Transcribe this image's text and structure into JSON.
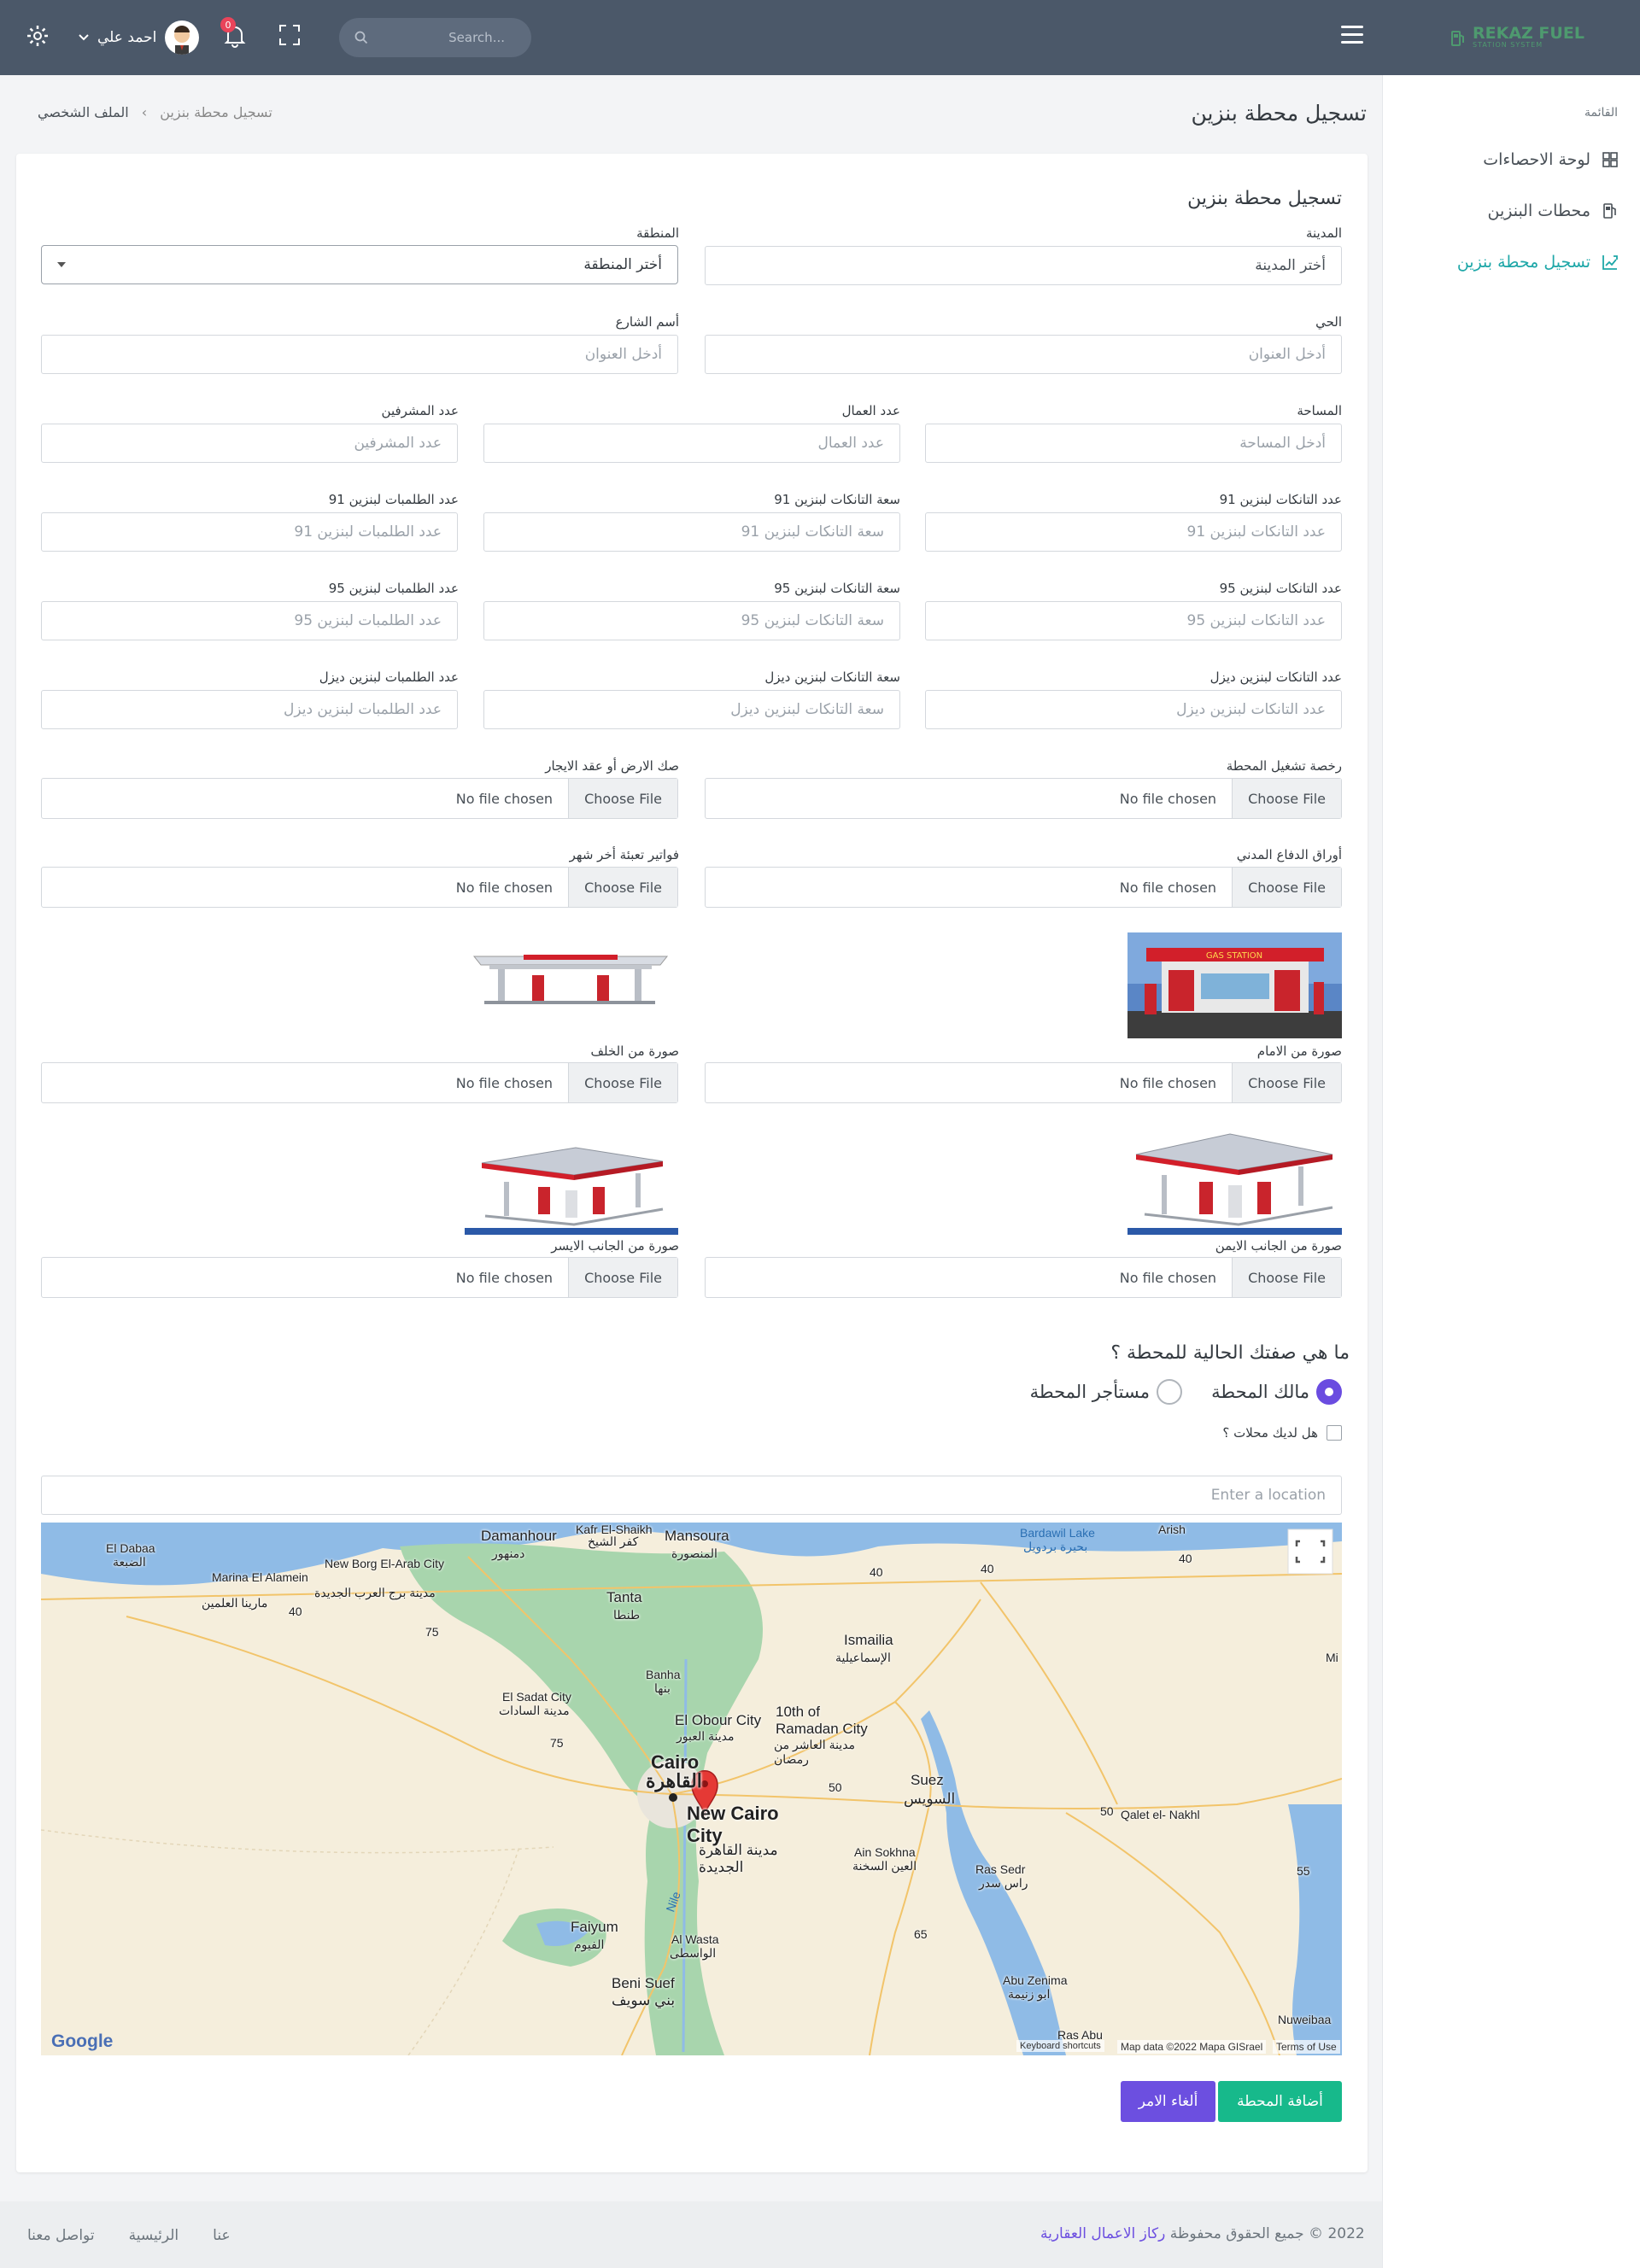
{
  "header": {
    "brand_name": "REKAZ FUEL",
    "brand_sub": "STATION SYSTEM",
    "search_placeholder": "Search...",
    "notifications_count": "0",
    "user_name": "احمد علي"
  },
  "sidebar": {
    "title": "القائمة",
    "items": [
      {
        "label": "لوحة الاحصاءات",
        "icon": "dashboard-icon"
      },
      {
        "label": "محطات البنزين",
        "icon": "fuel-pump-icon"
      },
      {
        "label": "تسجيل محطة بنزين",
        "icon": "chart-add-icon"
      }
    ]
  },
  "page": {
    "title": "تسجيل محطة بنزين",
    "breadcrumb_root": "الملف الشخصي",
    "breadcrumb_sep": "›",
    "breadcrumb_current": "تسجيل محطة بنزين"
  },
  "form": {
    "title": "تسجيل محطة بنزين",
    "city_label": "المدينة",
    "city_value": "أختر المدينة",
    "region_label": "المنطقة",
    "region_value": "أختر المنطقة",
    "district_label": "الحي",
    "district_placeholder": "أدخل العنوان",
    "street_label": "أسم الشارع",
    "street_placeholder": "أدخل العنوان",
    "area_label": "المساحة",
    "area_placeholder": "أدخل المساحة",
    "workers_label": "عدد العمال",
    "workers_placeholder": "عدد العمال",
    "supervisors_label": "عدد المشرفين",
    "supervisors_placeholder": "عدد المشرفين",
    "tanks91_label": "عدد التانكات لبنزين 91",
    "tanks91_placeholder": "عدد التانكات لبنزين 91",
    "cap91_label": "سعة التانكات لبنزين 91",
    "cap91_placeholder": "سعة التانكات لبنزين 91",
    "pumps91_label": "عدد الطلمبات لبنزين 91",
    "pumps91_placeholder": "عدد الطلمبات لبنزين 91",
    "tanks95_label": "عدد التانكات لبنزين 95",
    "tanks95_placeholder": "عدد التانكات لبنزين 95",
    "cap95_label": "سعة التانكات لبنزين 95",
    "cap95_placeholder": "سعة التانكات لبنزين 95",
    "pumps95_label": "عدد الطلمبات لبنزين 95",
    "pumps95_placeholder": "عدد الطلمبات لبنزين 95",
    "tanksd_label": "عدد التانكات لبنزين ديزل",
    "tanksd_placeholder": "عدد التانكات لبنزين ديزل",
    "capd_label": "سعة التانكات لبنزين ديزل",
    "capd_placeholder": "سعة التانكات لبنزين ديزل",
    "pumpsd_label": "عدد الطلمبات لبنزين ديزل",
    "pumpsd_placeholder": "عدد الطلمبات لبنزين ديزل",
    "license_label": "رخصة تشغيل المحطة",
    "deed_label": "صك الارض أو عقد الايجار",
    "civil_label": "أوراق الدفاع المدني",
    "bills_label": "فواتير تعبئة أخر شهر",
    "front_label": "صورة من الامام",
    "back_label": "صورة من الخلف",
    "right_label": "صورة من الجانب الايمن",
    "left_label": "صورة من الجانب الايسر",
    "choose_file": "Choose File",
    "no_file": "No file chosen",
    "front_img_text": "GAS STATION",
    "question": "ما هي صفتك الحالية للمحطة ؟",
    "owner_label": "مالك المحطة",
    "tenant_label": "مستأجر المحطة",
    "shops_label": "هل لديك محلات ؟",
    "location_placeholder": "Enter a location",
    "submit_label": "أضافة المحطة",
    "cancel_label": "ألغاء الامر"
  },
  "map": {
    "places": [
      "Damanhour",
      "دمنهور",
      "Kafr El-Shaikh",
      "كفر الشيخ",
      "Mansoura",
      "المنصورة",
      "El Dabaa",
      "الضبعة",
      "Marina El Alamein",
      "مارينا العلمين",
      "New Borg El-Arab City",
      "مدينة برج العرب الجديدة",
      "Tanta",
      "طنطا",
      "Ismailia",
      "الإسماعيلية",
      "Banha",
      "بنها",
      "El Sadat City",
      "مدينة السادات",
      "El Obour City",
      "مدينة العبور",
      "10th of Ramadan City",
      "مدينة العاشر من رمضان",
      "Cairo",
      "القاهرة",
      "New Cairo City",
      "مدينة القاهرة الجديدة",
      "Suez",
      "السويس",
      "Qalet el- Nakhl",
      "Ain Sokhna",
      "العين السخنة",
      "Ras Sedr",
      "راس سدر",
      "Faiyum",
      "الفيوم",
      "Al Wasta",
      "الواسطى",
      "Beni Suef",
      "بني سويف",
      "Abu Zenima",
      "ابو زنيمة",
      "Ras Abu",
      "Nuweibaa",
      "Bardawil Lake",
      "بحيرة بردويل",
      "Nile",
      "Arish",
      "Mi"
    ],
    "roads": [
      "40",
      "40",
      "40",
      "40",
      "75",
      "75",
      "50",
      "50",
      "65",
      "55"
    ],
    "attribution": "Map data ©2022 Mapa GISrael",
    "keyboard": "Keyboard shortcuts",
    "terms": "Terms of Use",
    "google": "Google"
  },
  "footer": {
    "copyright": "2022 © جميع الحقوق محفوظة ",
    "company": "ركاز الاعمال العقارية",
    "links": [
      "عنا",
      "الرئيسية",
      "تواصل معنا"
    ]
  },
  "colors": {
    "topbar": "#4b5869",
    "accent_teal": "#1ea7a8",
    "submit_green": "#17b98b",
    "cancel_purple": "#6c4fe0"
  }
}
